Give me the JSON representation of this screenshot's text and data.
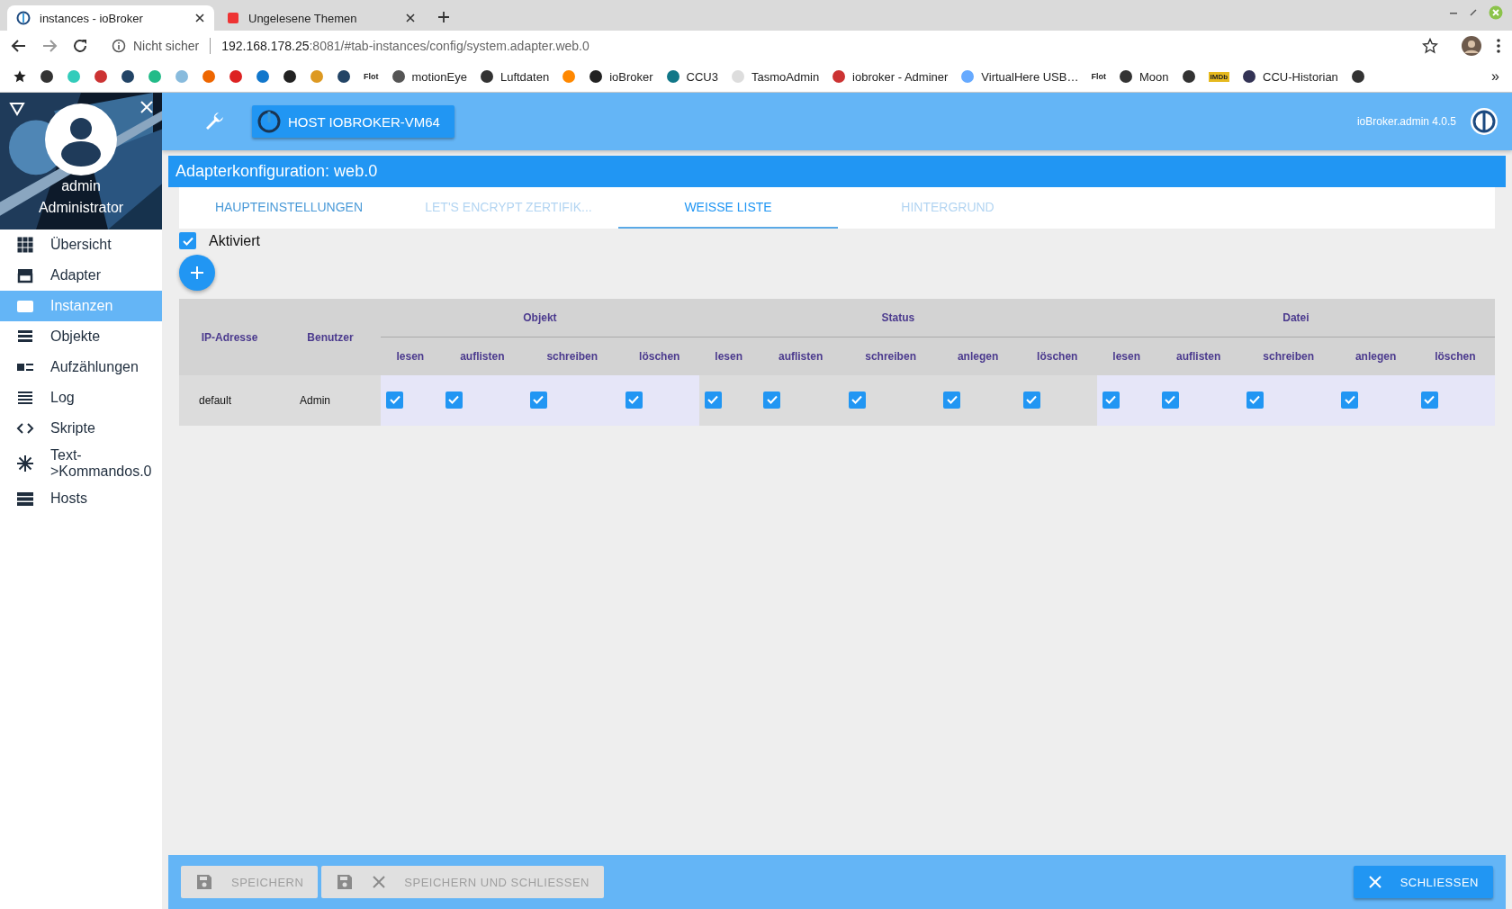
{
  "browser": {
    "tabs": [
      {
        "title": "instances - ioBroker",
        "selected": true
      },
      {
        "title": "Ungelesene Themen",
        "selected": false
      }
    ],
    "security": "Nicht sicher",
    "url_host": "192.168.178.25",
    "url_rest": ":8081/#tab-instances/config/system.adapter.web.0",
    "bookmarks": [
      {
        "kind": "icon"
      },
      {
        "kind": "icon"
      },
      {
        "kind": "icon"
      },
      {
        "kind": "icon"
      },
      {
        "kind": "icon"
      },
      {
        "kind": "icon"
      },
      {
        "kind": "icon"
      },
      {
        "kind": "icon"
      },
      {
        "kind": "icon"
      },
      {
        "kind": "icon"
      },
      {
        "kind": "icon"
      },
      {
        "kind": "icon"
      },
      {
        "kind": "tiny",
        "label": "Flot"
      },
      {
        "kind": "link",
        "label": "motionEye"
      },
      {
        "kind": "link",
        "label": "Luftdaten"
      },
      {
        "kind": "icon"
      },
      {
        "kind": "link",
        "label": "ioBroker"
      },
      {
        "kind": "link",
        "label": "CCU3"
      },
      {
        "kind": "link",
        "label": "TasmoAdmin"
      },
      {
        "kind": "link",
        "label": "iobroker - Adminer"
      },
      {
        "kind": "link",
        "label": "VirtualHere USB…"
      },
      {
        "kind": "tiny",
        "label": "Flot"
      },
      {
        "kind": "link",
        "label": "Moon"
      },
      {
        "kind": "icon"
      },
      {
        "kind": "badge",
        "label": "IMDb"
      },
      {
        "kind": "link",
        "label": "CCU-Historian"
      },
      {
        "kind": "icon"
      }
    ],
    "more": "»"
  },
  "sidebar": {
    "user": "admin",
    "role": "Administrator",
    "items": [
      {
        "label": "Übersicht",
        "selected": false
      },
      {
        "label": "Adapter",
        "selected": false
      },
      {
        "label": "Instanzen",
        "selected": true
      },
      {
        "label": "Objekte",
        "selected": false
      },
      {
        "label": "Aufzählungen",
        "selected": false
      },
      {
        "label": "Log",
        "selected": false
      },
      {
        "label": "Skripte",
        "selected": false
      },
      {
        "label": "Text->Kommandos.0",
        "selected": false
      },
      {
        "label": "Hosts",
        "selected": false
      }
    ]
  },
  "header": {
    "host": "HOST IOBROKER-VM64",
    "version": "ioBroker.admin 4.0.5"
  },
  "title": "Adapterkonfiguration: web.0",
  "tabs": [
    {
      "label": "HAUPTEINSTELLUNGEN",
      "selected": false,
      "disabled": false
    },
    {
      "label": "LET'S ENCRYPT ZERTIFIK...",
      "selected": false,
      "disabled": true
    },
    {
      "label": "WEISSE LISTE",
      "selected": true,
      "disabled": false
    },
    {
      "label": "HINTERGRUND",
      "selected": false,
      "disabled": true
    }
  ],
  "enabled": {
    "label": "Aktiviert",
    "checked": true
  },
  "table": {
    "columns": [
      "IP-Adresse",
      "Benutzer"
    ],
    "groups": [
      {
        "name": "Objekt",
        "columns": [
          "lesen",
          "auflisten",
          "schreiben",
          "löschen"
        ]
      },
      {
        "name": "Status",
        "columns": [
          "lesen",
          "auflisten",
          "schreiben",
          "anlegen",
          "löschen"
        ]
      },
      {
        "name": "Datei",
        "columns": [
          "lesen",
          "auflisten",
          "schreiben",
          "anlegen",
          "löschen"
        ]
      }
    ],
    "rows": [
      {
        "ip": "default",
        "user": "Admin",
        "groups": [
          [
            {
              "checked": true
            },
            {
              "checked": true
            },
            {
              "checked": true
            },
            {
              "checked": true
            }
          ],
          [
            {
              "checked": true
            },
            {
              "checked": true
            },
            {
              "checked": true
            },
            {
              "checked": true
            },
            {
              "checked": true
            }
          ],
          [
            {
              "checked": true
            },
            {
              "checked": true
            },
            {
              "checked": true
            },
            {
              "checked": true
            },
            {
              "checked": true
            }
          ]
        ]
      }
    ]
  },
  "footer": [
    {
      "label": "SPEICHERN",
      "disabled": true
    },
    {
      "label": "SPEICHERN UND SCHLIESSEN",
      "disabled": true
    },
    {
      "label": "SCHLIESSEN",
      "disabled": false
    }
  ]
}
